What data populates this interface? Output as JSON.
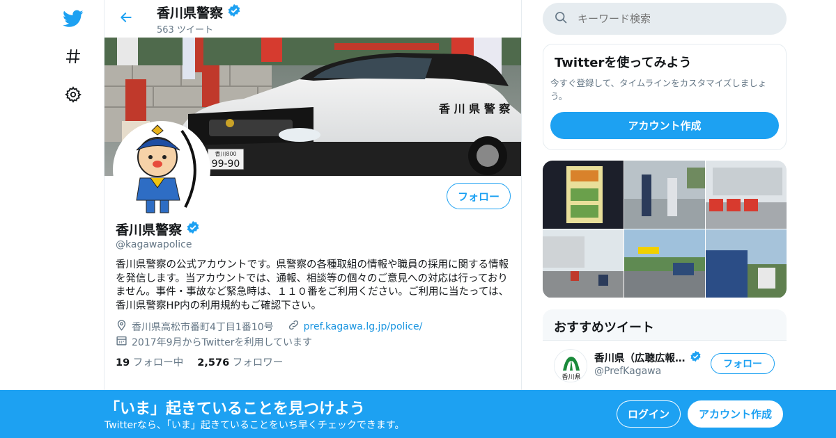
{
  "nav": {
    "icons": [
      "twitter-logo-icon",
      "hashtag-icon",
      "gear-icon"
    ]
  },
  "header": {
    "title": "香川県警察",
    "tweet_count": "563 ツイート"
  },
  "profile": {
    "name": "香川県警察",
    "handle": "@kagawapolice",
    "follow_label": "フォロー",
    "bio": "香川県警察の公式アカウントです。県警察の各種取組の情報や職員の採用に関する情報を発信します。当アカウントでは、通報、相談等の個々のご意見への対応は行っておりません。事件・事故など緊急時は、１１０番をご利用ください。ご利用に当たっては、香川県警察HP内の利用規約もご確認下さい。",
    "location": "香川県高松市番町4丁目1番10号",
    "website": "pref.kagawa.lg.jp/police/",
    "joined": "2017年9月からTwitterを利用しています",
    "following_count": "19",
    "following_label": "フォロー中",
    "followers_count": "2,576",
    "followers_label": "フォロワー",
    "banner_car_text": "香 川 県 警 察",
    "banner_plate": "99-90",
    "banner_plate_top": "香川800"
  },
  "search": {
    "placeholder": "キーワード検索"
  },
  "signup_card": {
    "title": "Twitterを使ってみよう",
    "description": "今すぐ登録して、タイムラインをカスタマイズしましょう。",
    "button": "アカウント作成"
  },
  "media": {
    "items": [
      "poster",
      "ceremony",
      "motorcycles",
      "parking-lot",
      "event-tent",
      "patrol-car"
    ]
  },
  "recommend": {
    "title": "おすすめツイート",
    "account_name": "香川県（広聴広報…",
    "account_handle": "@PrefKagawa",
    "follow_label": "フォロー",
    "logo_text": "香川県"
  },
  "bottom_bar": {
    "title": "「いま」起きていることを見つけよう",
    "subtitle": "Twitterなら、「いま」起きていることをいち早くチェックできます。",
    "login": "ログイン",
    "create_account": "アカウント作成"
  },
  "colors": {
    "accent": "#1da1f2",
    "secondary_text": "#657786",
    "border": "#e6ecf0"
  }
}
